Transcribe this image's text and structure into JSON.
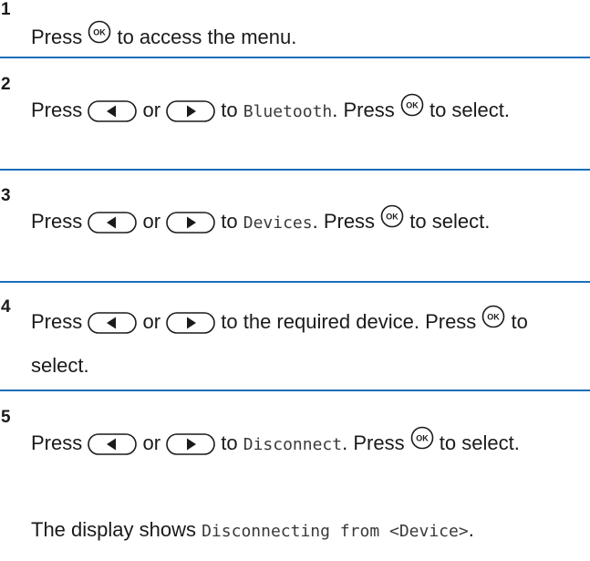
{
  "steps": [
    {
      "number": "1",
      "parts": [
        {
          "type": "text",
          "value": "Press "
        },
        {
          "type": "icon",
          "name": "ok-button-icon"
        },
        {
          "type": "text",
          "value": " to access the menu."
        }
      ]
    },
    {
      "number": "2",
      "parts": [
        {
          "type": "text",
          "value": "Press "
        },
        {
          "type": "icon",
          "name": "left-arrow-button-icon"
        },
        {
          "type": "text",
          "value": " or "
        },
        {
          "type": "icon",
          "name": "right-arrow-button-icon"
        },
        {
          "type": "text",
          "value": " to "
        },
        {
          "type": "mono",
          "value": "Bluetooth"
        },
        {
          "type": "text",
          "value": ". Press "
        },
        {
          "type": "icon",
          "name": "ok-button-icon"
        },
        {
          "type": "text",
          "value": " to select."
        }
      ]
    },
    {
      "number": "3",
      "parts": [
        {
          "type": "text",
          "value": "Press "
        },
        {
          "type": "icon",
          "name": "left-arrow-button-icon"
        },
        {
          "type": "text",
          "value": " or "
        },
        {
          "type": "icon",
          "name": "right-arrow-button-icon"
        },
        {
          "type": "text",
          "value": " to "
        },
        {
          "type": "mono",
          "value": "Devices"
        },
        {
          "type": "text",
          "value": ". Press "
        },
        {
          "type": "icon",
          "name": "ok-button-icon"
        },
        {
          "type": "text",
          "value": " to select."
        }
      ]
    },
    {
      "number": "4",
      "parts": [
        {
          "type": "text",
          "value": "Press "
        },
        {
          "type": "icon",
          "name": "left-arrow-button-icon"
        },
        {
          "type": "text",
          "value": " or "
        },
        {
          "type": "icon",
          "name": "right-arrow-button-icon"
        },
        {
          "type": "text",
          "value": " to the required device. Press "
        },
        {
          "type": "icon",
          "name": "ok-button-icon"
        },
        {
          "type": "text",
          "value": " to select."
        }
      ]
    },
    {
      "number": "5",
      "parts": [
        {
          "type": "text",
          "value": "Press "
        },
        {
          "type": "icon",
          "name": "left-arrow-button-icon"
        },
        {
          "type": "text",
          "value": " or "
        },
        {
          "type": "icon",
          "name": "right-arrow-button-icon"
        },
        {
          "type": "text",
          "value": " to "
        },
        {
          "type": "mono",
          "value": "Disconnect"
        },
        {
          "type": "text",
          "value": ". Press "
        },
        {
          "type": "icon",
          "name": "ok-button-icon"
        },
        {
          "type": "text",
          "value": " to select."
        }
      ],
      "result_parts": [
        {
          "type": "text",
          "value": "The display shows "
        },
        {
          "type": "mono",
          "value": "Disconnecting from <Device>"
        },
        {
          "type": "text",
          "value": "."
        }
      ]
    }
  ],
  "colors": {
    "divider": "#1b6fb8",
    "text": "#1a1a1a"
  }
}
